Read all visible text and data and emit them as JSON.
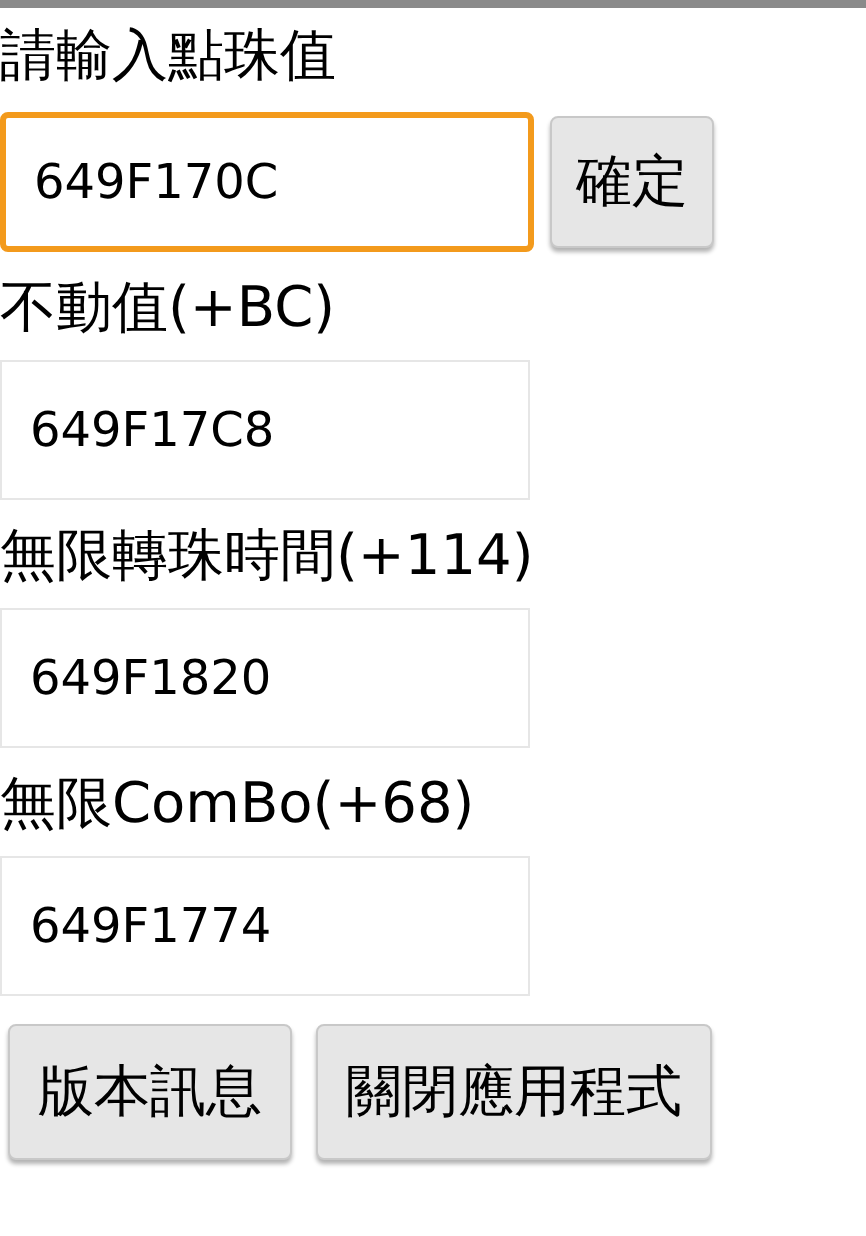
{
  "prompt": "請輸入點珠值",
  "input": {
    "value": "649F170C",
    "focused": true
  },
  "confirm_button": "確定",
  "results": [
    {
      "label": "不動值(+BC)",
      "value": "649F17C8"
    },
    {
      "label": "無限轉珠時間(+114)",
      "value": "649F1820"
    },
    {
      "label": "無限ComBo(+68)",
      "value": "649F1774"
    }
  ],
  "buttons": [
    "版本訊息",
    "關閉應用程式"
  ]
}
